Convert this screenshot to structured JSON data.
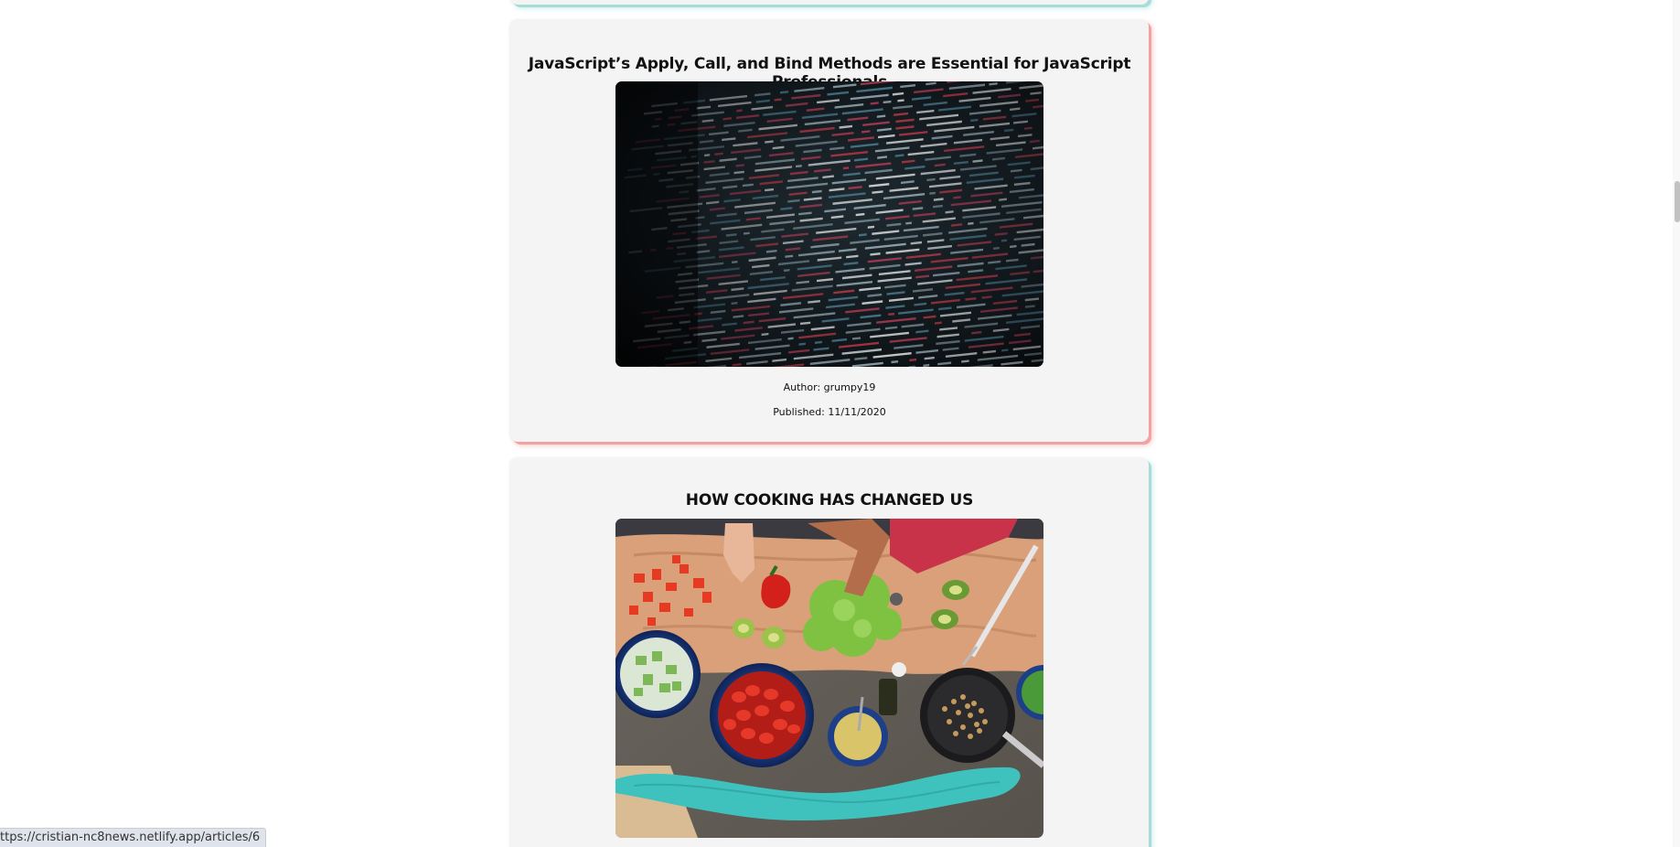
{
  "articles": [
    {
      "title": "JavaScript’s Apply, Call, and Bind Methods are Essential for JavaScript Professionals",
      "image_icon": "code-screen-image",
      "author": "Author: grumpy19",
      "published": "Published: 11/11/2020",
      "accent": "#f3a2a2"
    },
    {
      "title": "HOW COOKING HAS CHANGED US",
      "image_icon": "cooking-table-image",
      "accent": "#a7ddd7"
    }
  ],
  "status_bar": {
    "url": "ttps://cristian-nc8news.netlify.app/articles/6"
  }
}
